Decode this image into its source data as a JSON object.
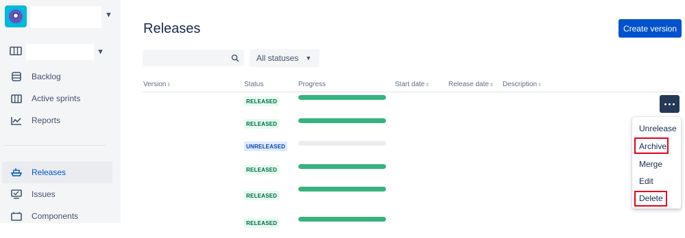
{
  "sidebar": {
    "project_name": "",
    "board_name": "",
    "nav_items": [
      {
        "label": "Backlog",
        "icon": "backlog-icon"
      },
      {
        "label": "Active sprints",
        "icon": "board-columns-icon"
      },
      {
        "label": "Reports",
        "icon": "reports-chart-icon"
      },
      {
        "label": "Releases",
        "icon": "ship-icon"
      },
      {
        "label": "Issues",
        "icon": "issues-icon"
      },
      {
        "label": "Components",
        "icon": "components-icon"
      }
    ],
    "active_item": "Releases"
  },
  "main": {
    "title": "Releases",
    "create_button": "Create version",
    "search": {
      "value": "",
      "placeholder": ""
    },
    "status_filter": "All statuses",
    "columns": [
      "Version",
      "Status",
      "Progress",
      "Start date",
      "Release date",
      "Description"
    ],
    "rows": [
      {
        "version": "",
        "status": "RELEASED",
        "progress": 1.0
      },
      {
        "version": "",
        "status": "RELEASED",
        "progress": 1.0
      },
      {
        "version": "",
        "status": "UNRELEASED",
        "progress": 0.0
      },
      {
        "version": "",
        "status": "RELEASED",
        "progress": 1.0
      },
      {
        "version": "",
        "status": "RELEASED",
        "progress": 1.0
      },
      {
        "version": "",
        "status": "RELEASED",
        "progress": 1.0
      }
    ]
  },
  "menu": {
    "items": [
      "Unrelease",
      "Archive",
      "Merge",
      "Edit",
      "Delete"
    ],
    "highlighted": [
      "Archive",
      "Delete"
    ]
  },
  "colors": {
    "primary": "#0052CC",
    "released_bg": "#E3FCEF",
    "released_text": "#006644",
    "unreleased_bg": "#DEEBFF",
    "unreleased_text": "#0747A6",
    "progress_fill": "#36B37E",
    "highlight_border": "#E3001B"
  }
}
